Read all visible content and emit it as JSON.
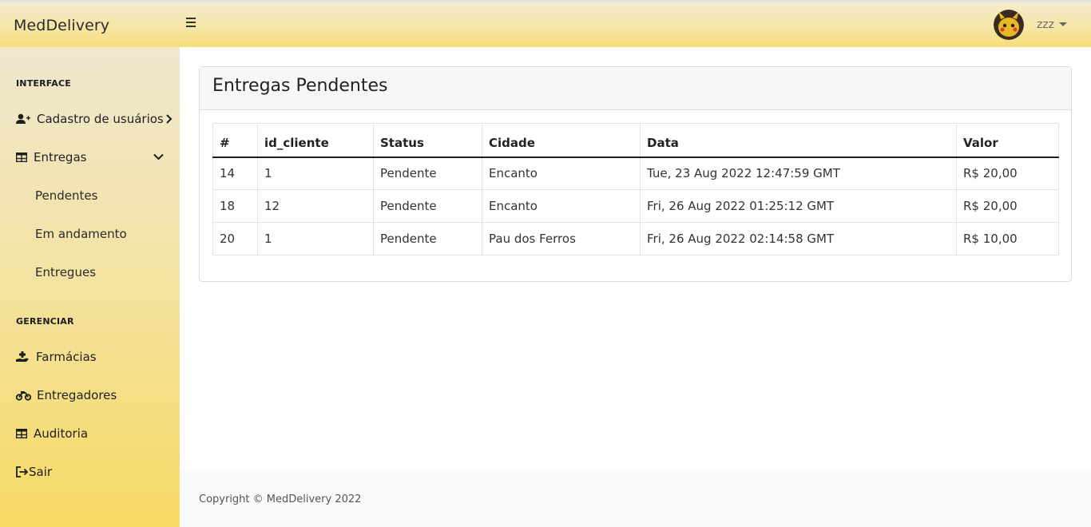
{
  "header": {
    "brand": "MedDelivery",
    "username": "zzz"
  },
  "sidebar": {
    "section_interface": "INTERFACE",
    "cadastro": "Cadastro de usuários",
    "entregas": "Entregas",
    "sub_pendentes": "Pendentes",
    "sub_andamento": "Em andamento",
    "sub_entregues": "Entregues",
    "section_gerenciar": "GERENCIAR",
    "farmacias": "Farmácias",
    "entregadores": "Entregadores",
    "auditoria": "Auditoria",
    "sair": "Sair"
  },
  "main": {
    "title": "Entregas Pendentes",
    "columns": [
      "#",
      "id_cliente",
      "Status",
      "Cidade",
      "Data",
      "Valor"
    ],
    "rows": [
      [
        "14",
        "1",
        "Pendente",
        "Encanto",
        "Tue, 23 Aug 2022 12:47:59 GMT",
        "R$ 20,00"
      ],
      [
        "18",
        "12",
        "Pendente",
        "Encanto",
        "Fri, 26 Aug 2022 01:25:12 GMT",
        "R$ 20,00"
      ],
      [
        "20",
        "1",
        "Pendente",
        "Pau dos Ferros",
        "Fri, 26 Aug 2022 02:14:58 GMT",
        "R$ 10,00"
      ]
    ]
  },
  "footer": {
    "copyright": "Copyright © MedDelivery 2022"
  },
  "icons": {
    "menu": "hamburger-icon",
    "user_add": "user-plus-icon",
    "table": "table-icon",
    "hand": "hand-holding-medical-icon",
    "motorcycle": "motorcycle-icon",
    "logout": "sign-out-icon"
  }
}
